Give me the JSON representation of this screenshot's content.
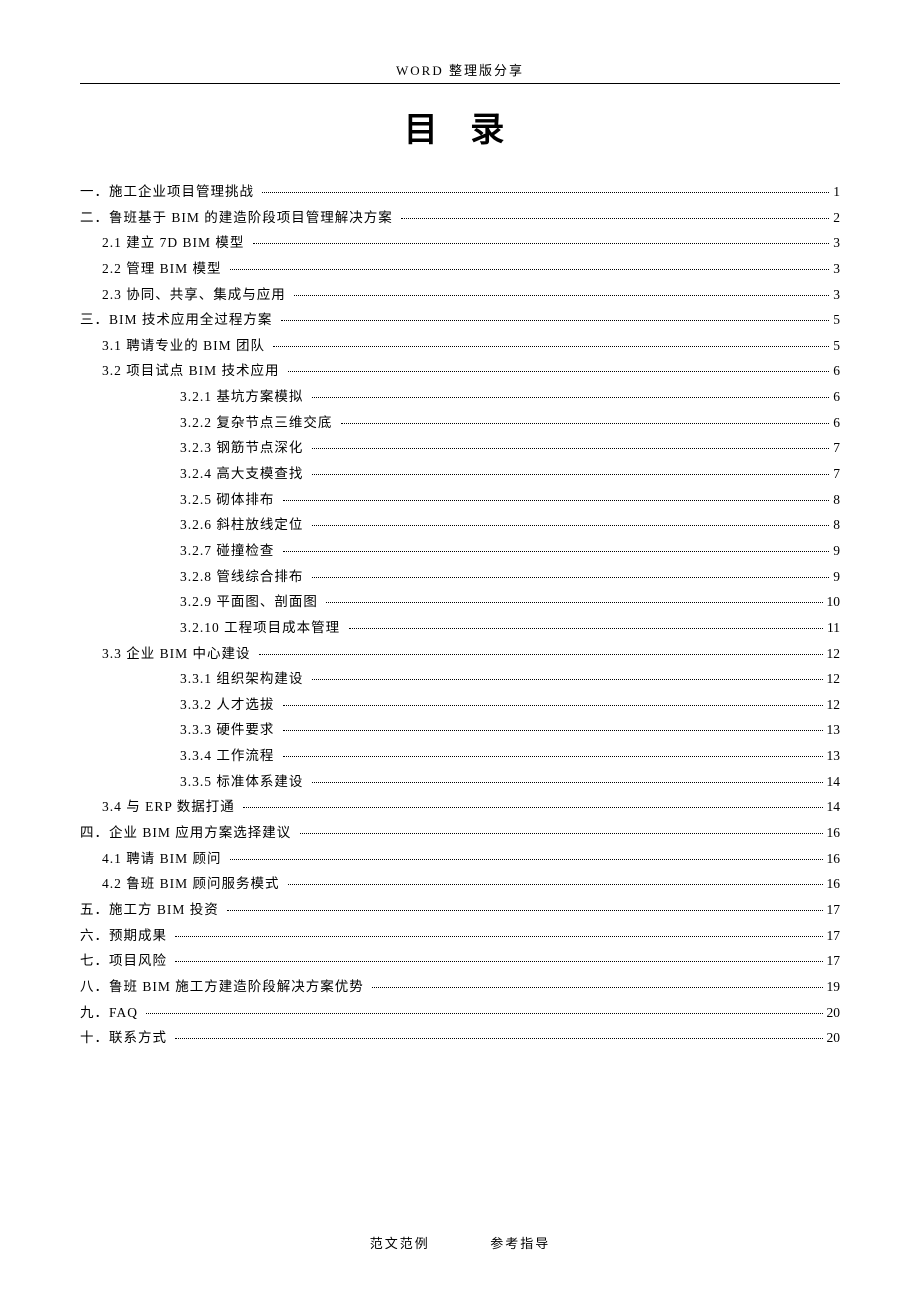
{
  "header": "WORD 整理版分享",
  "title": "目 录",
  "footer_left": "范文范例",
  "footer_right": "参考指导",
  "toc": [
    {
      "indent": 0,
      "label": "一．施工企业项目管理挑战",
      "page": "1"
    },
    {
      "indent": 0,
      "label": "二．鲁班基于 BIM 的建造阶段项目管理解决方案",
      "page": "2"
    },
    {
      "indent": 1,
      "label": "2.1 建立 7D BIM 模型",
      "page": "3"
    },
    {
      "indent": 1,
      "label": "2.2 管理 BIM 模型",
      "page": "3"
    },
    {
      "indent": 1,
      "label": "2.3 协同、共享、集成与应用",
      "page": "3"
    },
    {
      "indent": 0,
      "label": "三．BIM 技术应用全过程方案",
      "page": "5"
    },
    {
      "indent": 1,
      "label": "3.1 聘请专业的 BIM 团队",
      "page": "5"
    },
    {
      "indent": 1,
      "label": "3.2 项目试点 BIM 技术应用",
      "page": "6"
    },
    {
      "indent": 2,
      "label": "3.2.1 基坑方案模拟",
      "page": "6"
    },
    {
      "indent": 2,
      "label": "3.2.2 复杂节点三维交底",
      "page": "6"
    },
    {
      "indent": 2,
      "label": "3.2.3 钢筋节点深化",
      "page": "7"
    },
    {
      "indent": 2,
      "label": "3.2.4 高大支模查找",
      "page": "7"
    },
    {
      "indent": 2,
      "label": "3.2.5 砌体排布",
      "page": "8"
    },
    {
      "indent": 2,
      "label": "3.2.6 斜柱放线定位",
      "page": "8"
    },
    {
      "indent": 2,
      "label": "3.2.7 碰撞检查",
      "page": "9"
    },
    {
      "indent": 2,
      "label": "3.2.8 管线综合排布",
      "page": "9"
    },
    {
      "indent": 2,
      "label": "3.2.9 平面图、剖面图",
      "page": "10"
    },
    {
      "indent": 2,
      "label": "3.2.10 工程项目成本管理",
      "page": "11"
    },
    {
      "indent": 1,
      "label": "3.3 企业 BIM 中心建设",
      "page": "12"
    },
    {
      "indent": 2,
      "label": "3.3.1 组织架构建设",
      "page": "12"
    },
    {
      "indent": 2,
      "label": "3.3.2 人才选拔",
      "page": "12"
    },
    {
      "indent": 2,
      "label": "3.3.3 硬件要求",
      "page": "13"
    },
    {
      "indent": 2,
      "label": "3.3.4 工作流程",
      "page": "13"
    },
    {
      "indent": 2,
      "label": "3.3.5 标准体系建设",
      "page": "14"
    },
    {
      "indent": 1,
      "label": "3.4 与 ERP 数据打通",
      "page": "14"
    },
    {
      "indent": 0,
      "label": "四．企业 BIM 应用方案选择建议",
      "page": "16"
    },
    {
      "indent": 1,
      "label": "4.1 聘请 BIM 顾问",
      "page": "16"
    },
    {
      "indent": 1,
      "label": "4.2 鲁班 BIM 顾问服务模式",
      "page": "16"
    },
    {
      "indent": 0,
      "label": "五．施工方 BIM 投资",
      "page": "17"
    },
    {
      "indent": 0,
      "label": "六．预期成果",
      "page": "17"
    },
    {
      "indent": 0,
      "label": "七．项目风险",
      "page": "17"
    },
    {
      "indent": 0,
      "label": "八．鲁班 BIM 施工方建造阶段解决方案优势",
      "page": "19"
    },
    {
      "indent": 0,
      "label": "九．FAQ",
      "page": "20"
    },
    {
      "indent": 0,
      "label": "十．联系方式",
      "page": "20"
    }
  ]
}
